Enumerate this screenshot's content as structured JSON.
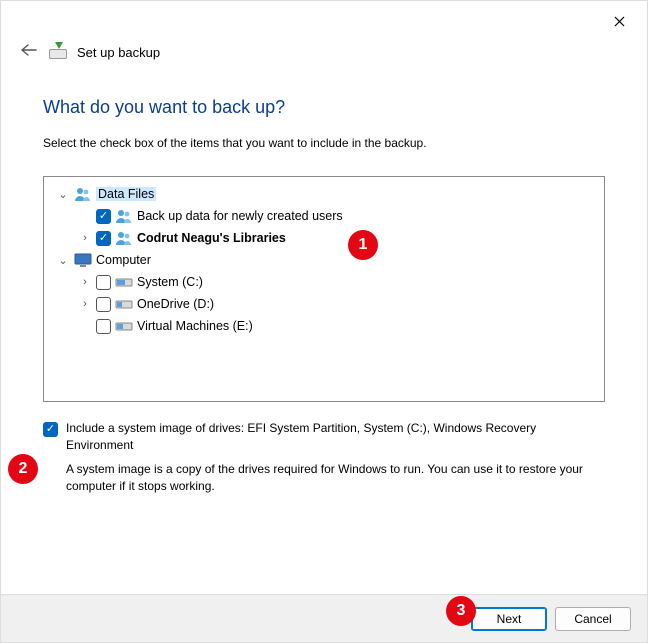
{
  "window": {
    "title": "Set up backup"
  },
  "heading": "What do you want to back up?",
  "subheading": "Select the check box of the items that you want to include in the backup.",
  "tree": {
    "data_files": {
      "label": "Data Files",
      "item_newusers": "Back up data for newly created users",
      "item_libraries": "Codrut Neagu's Libraries"
    },
    "computer": {
      "label": "Computer",
      "system": "System (C:)",
      "onedrive": "OneDrive (D:)",
      "vms": "Virtual Machines (E:)"
    }
  },
  "system_image": {
    "label": "Include a system image of drives: EFI System Partition, System (C:), Windows Recovery Environment",
    "description": "A system image is a copy of the drives required for Windows to run. You can use it to restore your computer if it stops working."
  },
  "buttons": {
    "next": "Next",
    "cancel": "Cancel"
  },
  "annotations": {
    "b1": "1",
    "b2": "2",
    "b3": "3"
  }
}
